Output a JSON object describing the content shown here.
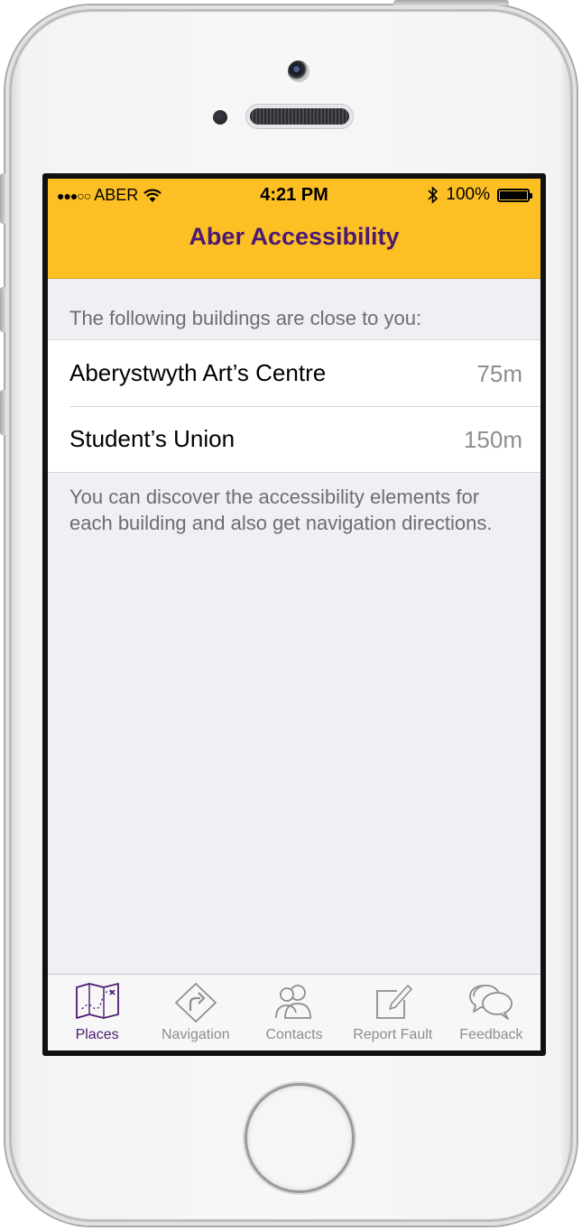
{
  "status_bar": {
    "signal": "●●●○○",
    "carrier": "ABER",
    "time": "4:21 PM",
    "battery": "100%"
  },
  "nav": {
    "title": "Aber Accessibility"
  },
  "header": "The following buildings are close to you:",
  "buildings": [
    {
      "name": "Aberystwyth Art’s Centre",
      "distance": "75m"
    },
    {
      "name": "Student’s Union",
      "distance": "150m"
    }
  ],
  "footer": "You can discover the accessibility elements for each building and also get navigation directions.",
  "tabs": [
    {
      "label": "Places",
      "icon": "map-icon",
      "active": true
    },
    {
      "label": "Navigation",
      "icon": "turn-sign-icon",
      "active": false
    },
    {
      "label": "Contacts",
      "icon": "people-icon",
      "active": false
    },
    {
      "label": "Report Fault",
      "icon": "compose-icon",
      "active": false
    },
    {
      "label": "Feedback",
      "icon": "speech-bubbles-icon",
      "active": false
    }
  ],
  "colors": {
    "nav_bar": "#fdc024",
    "title": "#4b1a72",
    "active_tab": "#4b1a72",
    "inactive_tab": "#8e8e93"
  }
}
